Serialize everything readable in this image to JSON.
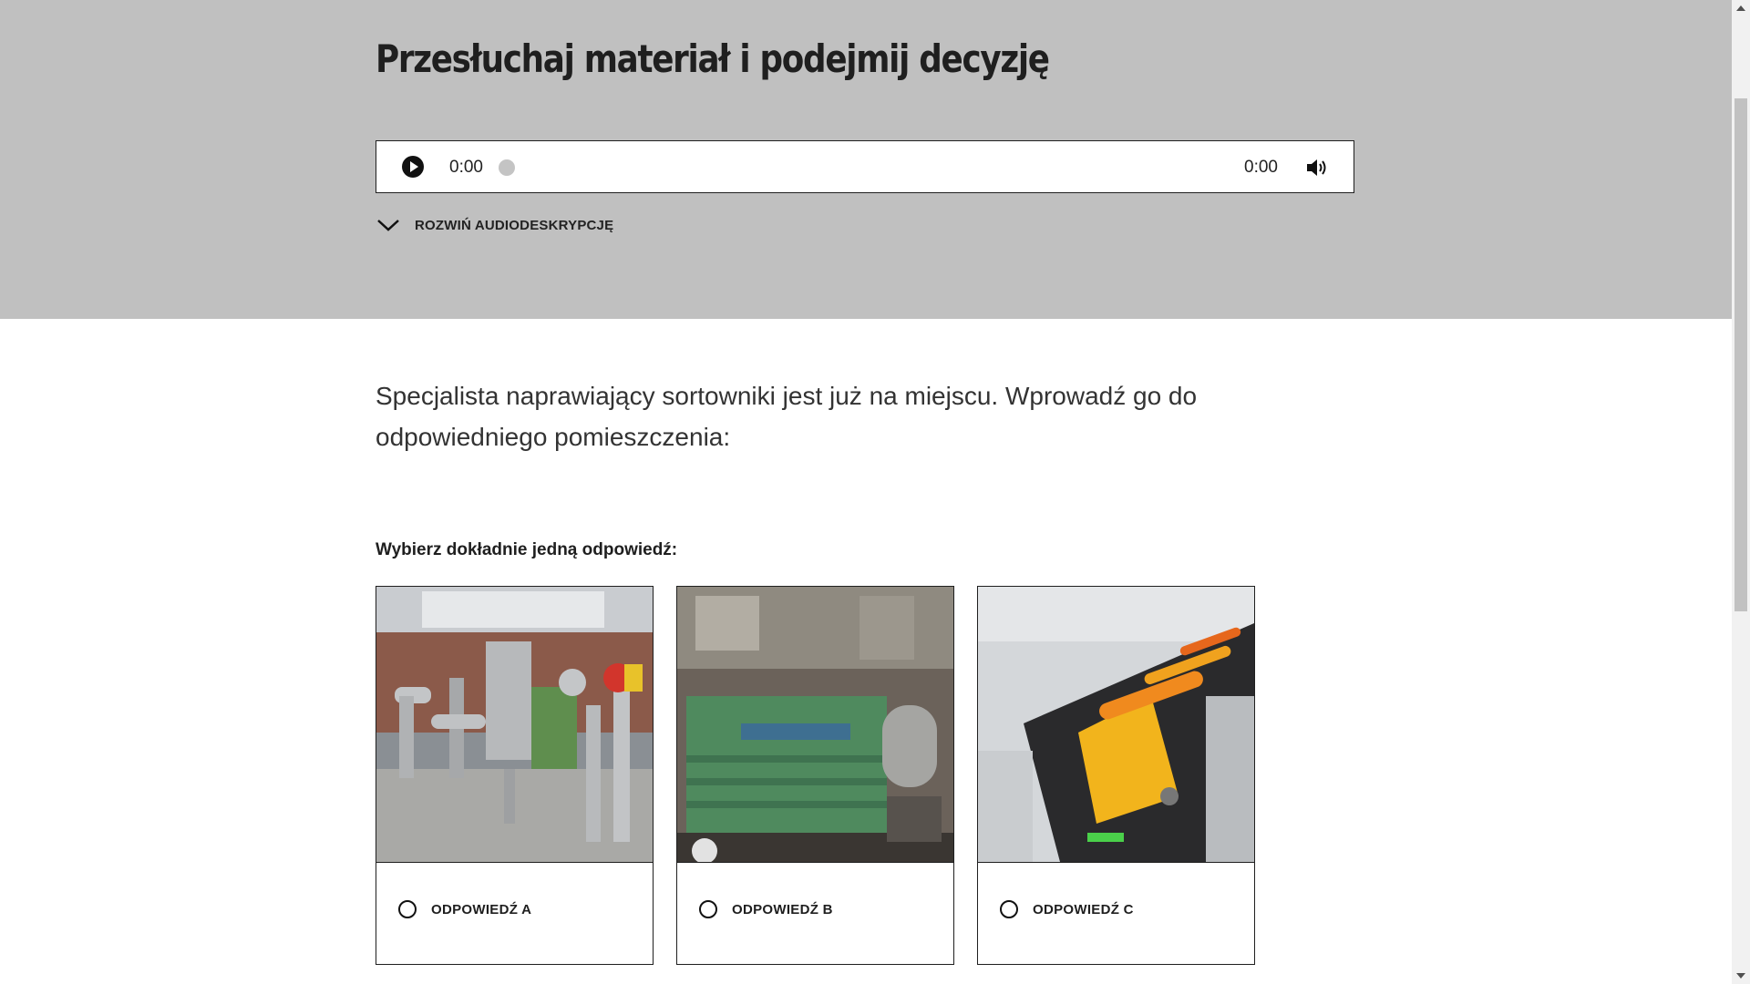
{
  "header": {
    "title": "Przesłuchaj materiał i podejmij decyzję"
  },
  "audio_player": {
    "current_time": "0:00",
    "total_time": "0:00",
    "progress": 0
  },
  "audio_description": {
    "toggle_label": "ROZWIŃ AUDIODESKRYPCJĘ"
  },
  "task": {
    "text": "Specjalista naprawiający sortowniki jest już na miejscu. Wprowadź go do odpowiedniego pomieszczenia:",
    "instruction": "Wybierz dokładnie jedną odpowiedź:"
  },
  "answers": [
    {
      "label": "ODPOWIEDŹ A",
      "selected": false
    },
    {
      "label": "ODPOWIEDŹ B",
      "selected": false
    },
    {
      "label": "ODPOWIEDŹ C",
      "selected": false
    }
  ],
  "colors": {
    "header_bg": "#c0c0c0",
    "text": "#1f1f1f",
    "border": "#1f1f1f"
  }
}
